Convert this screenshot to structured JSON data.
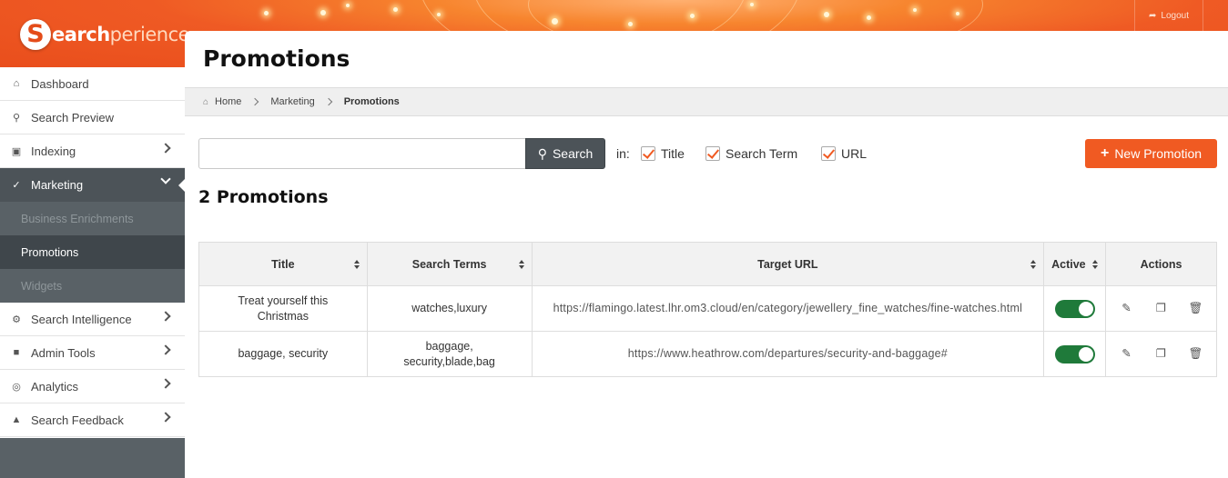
{
  "brand": {
    "logo_initial": "S",
    "logo_rest_dark": "earch",
    "logo_rest_light": "perience",
    "accent": "#f05a22"
  },
  "header": {
    "logout_label": "Logout"
  },
  "sidebar": {
    "items": [
      {
        "label": "Dashboard",
        "icon": "home-icon"
      },
      {
        "label": "Search Preview",
        "icon": "search-icon"
      },
      {
        "label": "Indexing",
        "icon": "inbox-icon"
      },
      {
        "label": "Marketing",
        "icon": "magic-wand-icon"
      },
      {
        "label": "Search Intelligence",
        "icon": "gear-icon"
      },
      {
        "label": "Admin Tools",
        "icon": "lock-icon"
      },
      {
        "label": "Analytics",
        "icon": "dashboard-gauge-icon"
      },
      {
        "label": "Search Feedback",
        "icon": "thumbs-up-icon"
      }
    ],
    "marketing_sub": [
      "Business Enrichments",
      "Promotions",
      "Widgets"
    ]
  },
  "page": {
    "title": "Promotions"
  },
  "breadcrumb": {
    "home": "Home",
    "section": "Marketing",
    "current": "Promotions"
  },
  "search": {
    "value": "",
    "button_label": "Search",
    "in_label": "in:",
    "filters": [
      "Title",
      "Search Term",
      "URL"
    ]
  },
  "new_button_label": "New Promotion",
  "count_title": "2 Promotions",
  "table": {
    "headers": [
      "Title",
      "Search Terms",
      "Target URL",
      "Active",
      "Actions"
    ],
    "rows": [
      {
        "title": "Treat yourself this Christmas",
        "terms": "watches,luxury",
        "url": "https://flamingo.latest.lhr.om3.cloud/en/category/jewellery_fine_watches/fine-watches.html"
      },
      {
        "title": "baggage, security",
        "terms": "baggage, security,blade,bag",
        "url": "https://www.heathrow.com/departures/security-and-baggage#"
      }
    ]
  }
}
